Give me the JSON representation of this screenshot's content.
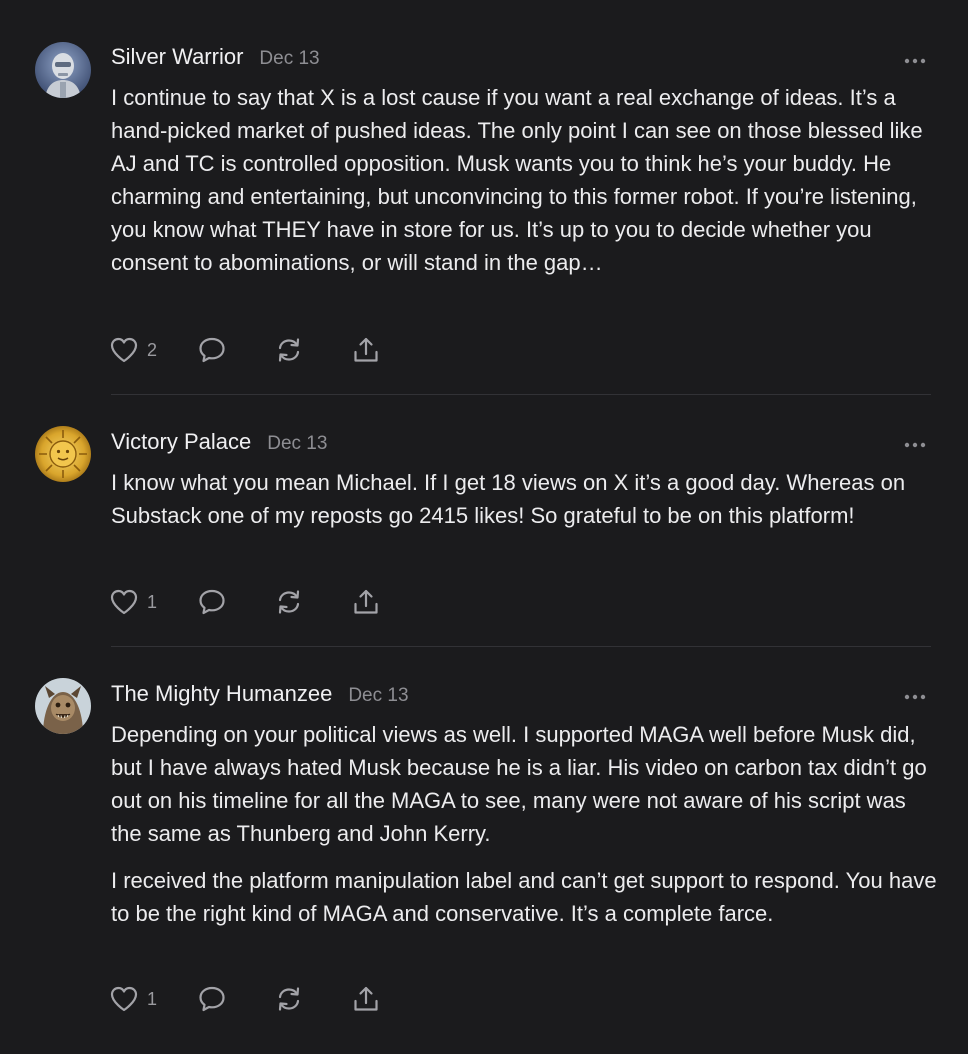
{
  "colors": {
    "background": "#1b1b1d",
    "text": "#ececee",
    "muted": "#8e8e93",
    "icon": "#a3a3a8",
    "divider": "#323236"
  },
  "comments": [
    {
      "author": "Silver Warrior",
      "date": "Dec 13",
      "avatar_icon": "robot-avatar",
      "paragraphs": [
        "I continue to say that X is a lost cause if you want a real exchange of ideas. It’s a hand-picked market of pushed ideas. The only point I can see on those blessed like AJ and TC is controlled opposition. Musk wants you to think he’s your buddy. He charming and entertaining, but unconvincing to this former robot. If you’re listening, you know what THEY have in store for us. It’s up to you to decide whether you consent to abominations, or will stand in the gap…"
      ],
      "likes": "2"
    },
    {
      "author": "Victory Palace",
      "date": "Dec 13",
      "avatar_icon": "golden-sun-avatar",
      "paragraphs": [
        "I know what you mean Michael. If I get 18 views on X it’s a good day. Whereas on Substack one of my reposts go 2415 likes! So grateful to be on this platform!"
      ],
      "likes": "1"
    },
    {
      "author": "The Mighty Humanzee",
      "date": "Dec 13",
      "avatar_icon": "creature-avatar",
      "paragraphs": [
        "Depending on your political views as well. I supported MAGA well before Musk did, but I have always hated Musk because he is a liar. His video on carbon tax didn’t go out on his timeline for all the MAGA to see, many were not aware of his script was the same as Thunberg and John Kerry.",
        "I received the platform manipulation label and can’t get support to respond. You have to be the right kind of MAGA and conservative. It’s a complete farce."
      ],
      "likes": "1"
    }
  ],
  "icons": {
    "like": "heart-icon",
    "reply": "speech-bubble-icon",
    "restack": "restack-arrows-icon",
    "share": "share-upload-icon",
    "more": "ellipsis-icon"
  }
}
